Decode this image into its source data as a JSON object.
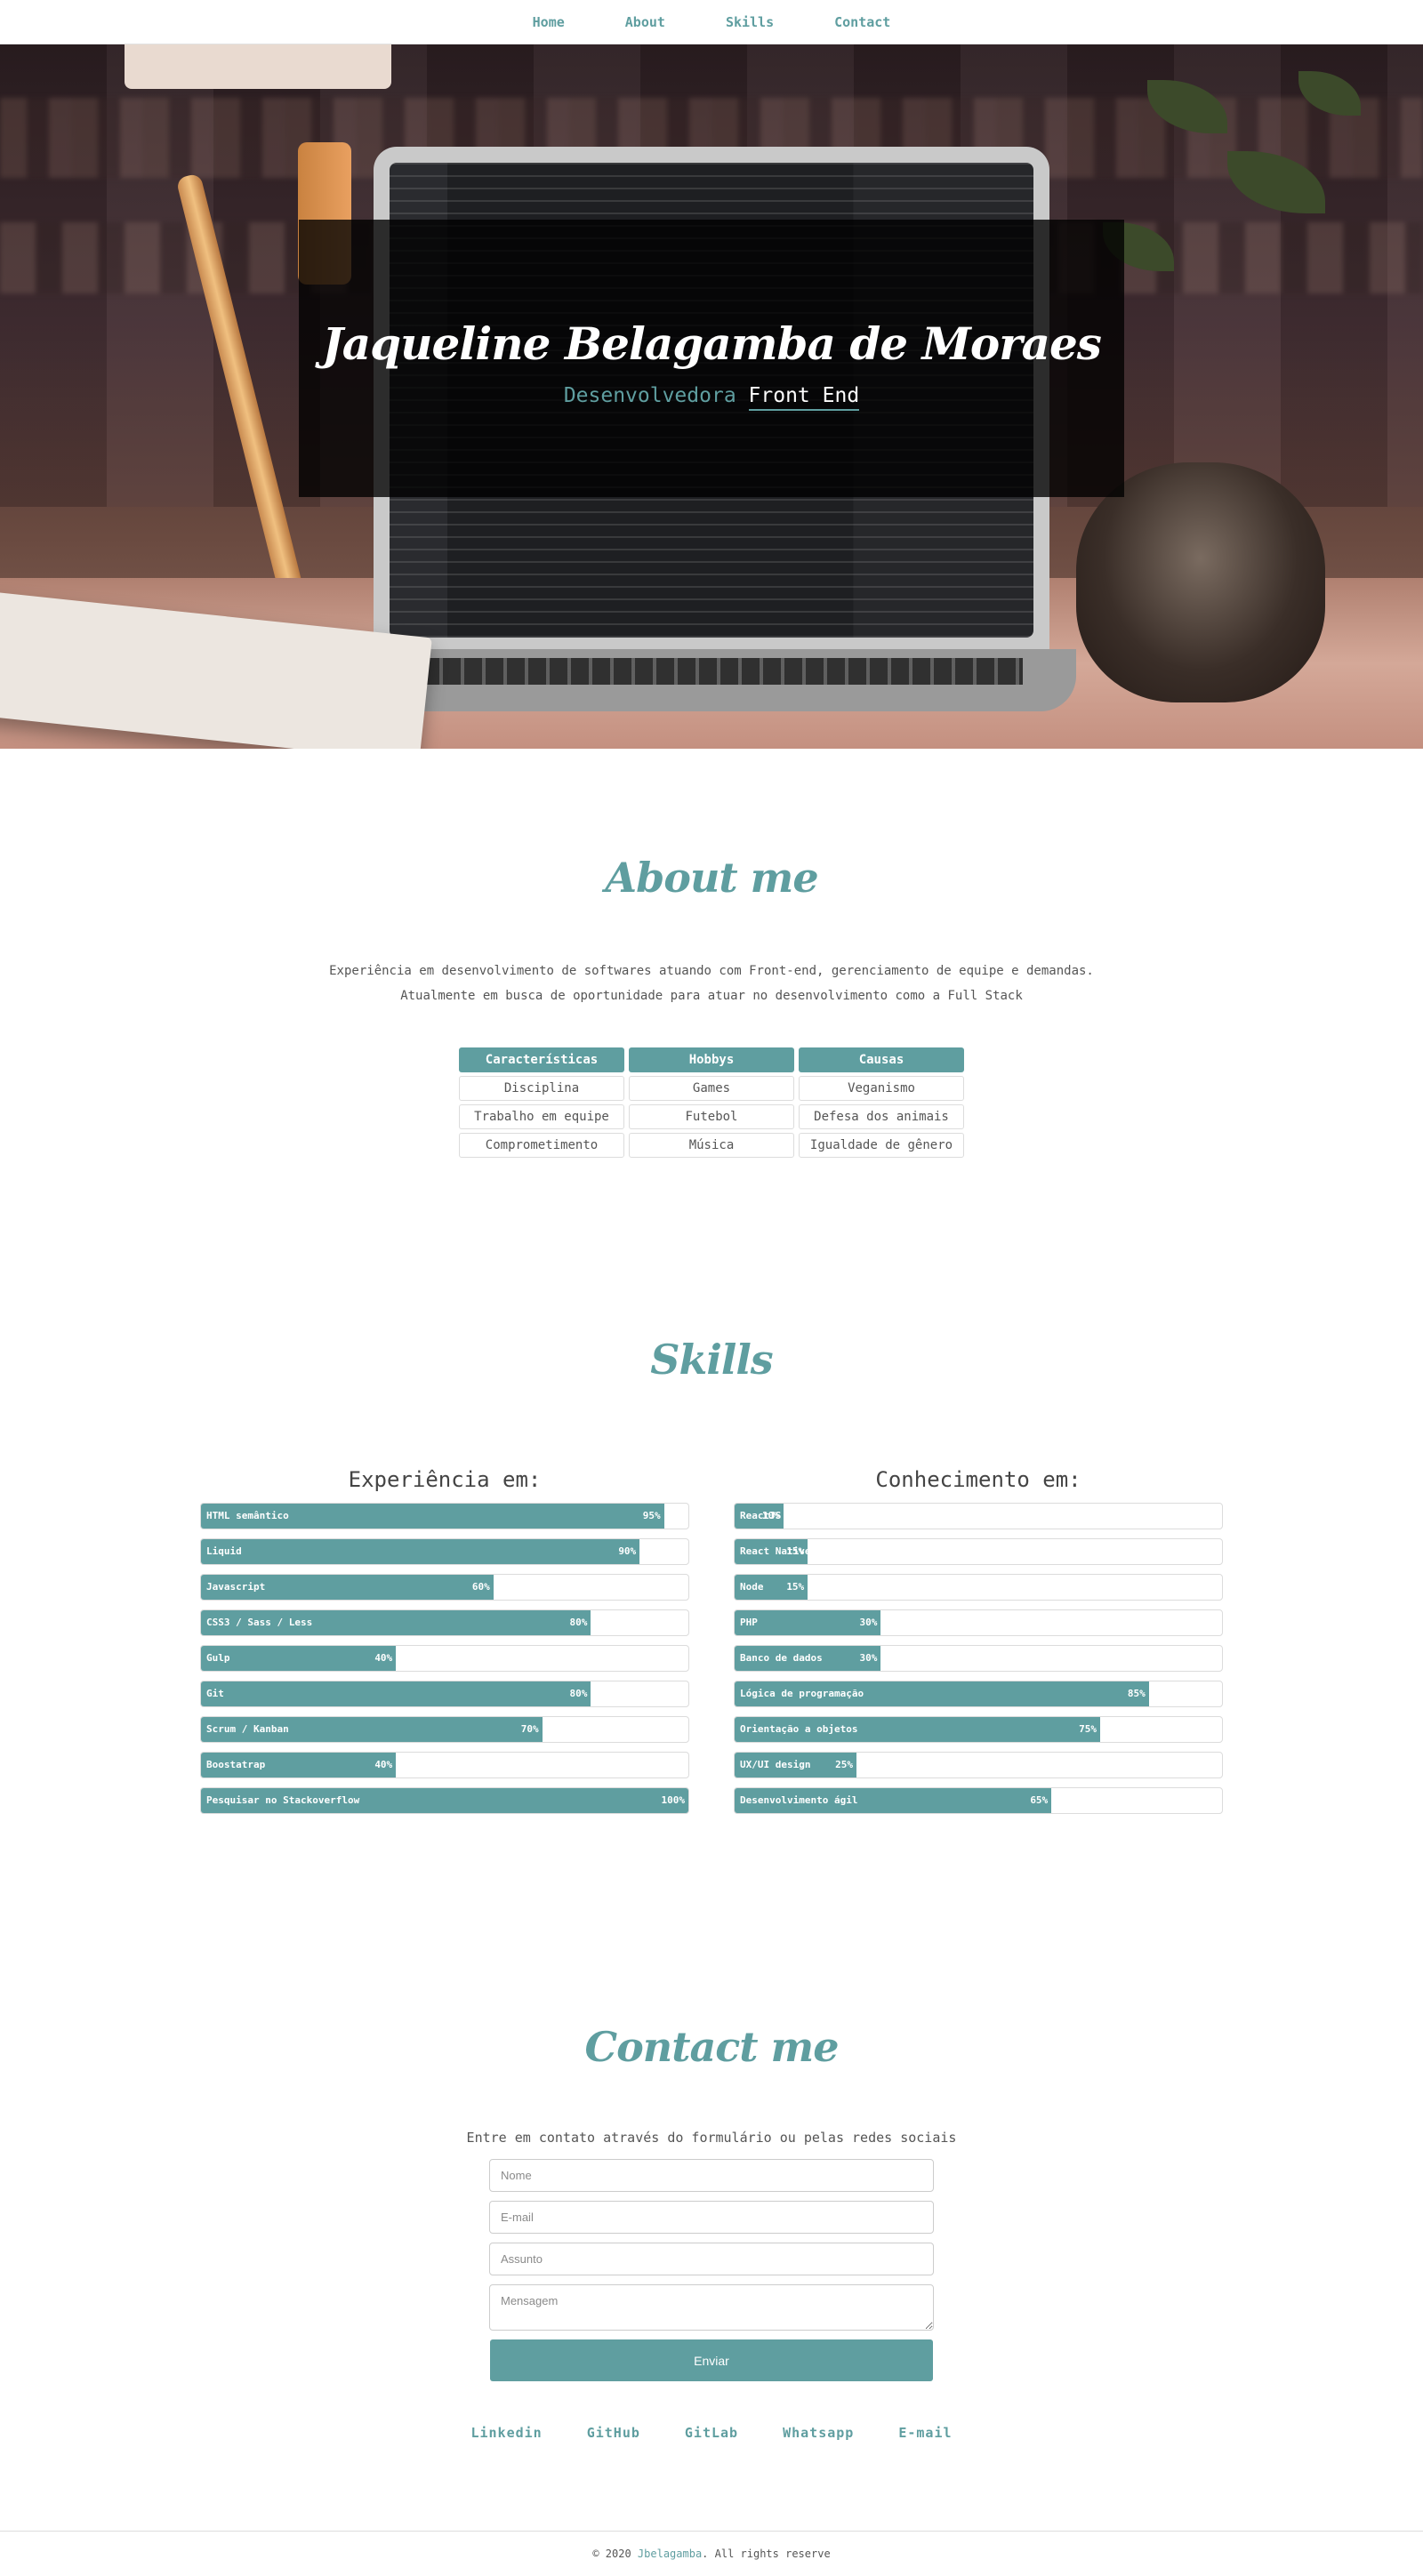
{
  "nav": {
    "items": [
      "Home",
      "About",
      "Skills",
      "Contact"
    ]
  },
  "hero": {
    "name": "Jaqueline Belagamba de Moraes",
    "role_prefix": "Desenvolvedora",
    "role_highlight": "Front End"
  },
  "about": {
    "title": "About me",
    "text_line1": "Experiência em desenvolvimento de softwares atuando com Front-end, gerenciamento de equipe e demandas.",
    "text_line2": "Atualmente em busca de oportunidade para atuar no desenvolvimento como a Full Stack",
    "table": {
      "headers": [
        "Características",
        "Hobbys",
        "Causas"
      ],
      "rows": [
        [
          "Disciplina",
          "Games",
          "Veganismo"
        ],
        [
          "Trabalho em equipe",
          "Futebol",
          "Defesa dos animais"
        ],
        [
          "Comprometimento",
          "Música",
          "Igualdade de gênero"
        ]
      ]
    }
  },
  "skills": {
    "title": "Skills",
    "experience": {
      "title": "Experiência em:",
      "items": [
        {
          "label": "HTML semântico",
          "percent": 95,
          "text": "95%"
        },
        {
          "label": "Liquid",
          "percent": 90,
          "text": "90%"
        },
        {
          "label": "Javascript",
          "percent": 60,
          "text": "60%"
        },
        {
          "label": "CSS3 / Sass / Less",
          "percent": 80,
          "text": "80%"
        },
        {
          "label": "Gulp",
          "percent": 40,
          "text": "40%"
        },
        {
          "label": "Git",
          "percent": 80,
          "text": "80%"
        },
        {
          "label": "Scrum / Kanban",
          "percent": 70,
          "text": "70%"
        },
        {
          "label": "Boostatrap",
          "percent": 40,
          "text": "40%"
        },
        {
          "label": "Pesquisar no Stackoverflow",
          "percent": 100,
          "text": "100%"
        }
      ]
    },
    "knowledge": {
      "title": "Conhecimento em:",
      "items": [
        {
          "label": "ReactJS",
          "percent": 10,
          "text": "10%"
        },
        {
          "label": "React Native",
          "percent": 15,
          "text": "15%"
        },
        {
          "label": "Node",
          "percent": 15,
          "text": "15%"
        },
        {
          "label": "PHP",
          "percent": 30,
          "text": "30%"
        },
        {
          "label": "Banco de dados",
          "percent": 30,
          "text": "30%"
        },
        {
          "label": "Lógica de programação",
          "percent": 85,
          "text": "85%"
        },
        {
          "label": "Orientação a objetos",
          "percent": 75,
          "text": "75%"
        },
        {
          "label": "UX/UI design",
          "percent": 25,
          "text": "25%"
        },
        {
          "label": "Desenvolvimento ágil",
          "percent": 65,
          "text": "65%"
        }
      ]
    }
  },
  "contact": {
    "title": "Contact me",
    "text": "Entre em contato através do formulário ou pelas redes sociais",
    "fields": {
      "name_placeholder": "Nome",
      "email_placeholder": "E-mail",
      "subject_placeholder": "Assunto",
      "message_placeholder": "Mensagem"
    },
    "submit_label": "Enviar",
    "social": [
      "Linkedin",
      "GitHub",
      "GitLab",
      "Whatsapp",
      "E-mail"
    ]
  },
  "footer": {
    "prefix": "© 2020",
    "author": "Jbelagamba",
    "suffix": ". All rights reserve"
  },
  "colors": {
    "accent": "#5f9ea0",
    "text": "#555555",
    "border": "#dcdcdc"
  }
}
